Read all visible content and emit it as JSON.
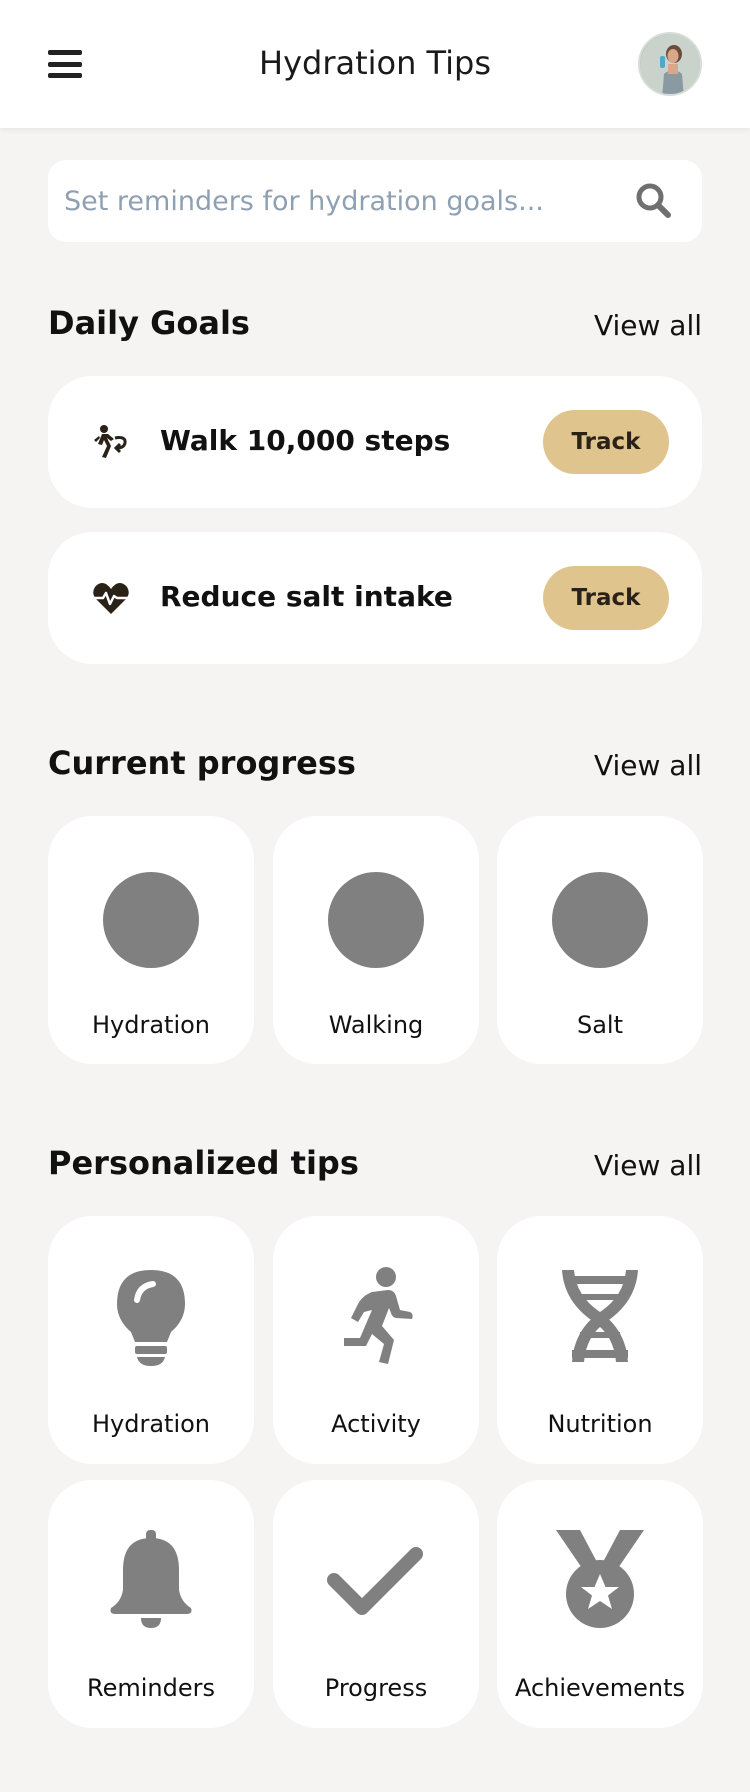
{
  "header": {
    "title": "Hydration Tips",
    "menu_icon": "hamburger-menu-icon",
    "avatar_alt": "User avatar"
  },
  "search": {
    "placeholder": "Set reminders for hydration goals...",
    "value": "",
    "icon": "search-icon"
  },
  "daily_goals": {
    "title": "Daily Goals",
    "view_all": "View all",
    "items": [
      {
        "icon": "walking-icon",
        "label": "Walk 10,000 steps",
        "button": "Track"
      },
      {
        "icon": "heart-pulse-icon",
        "label": "Reduce salt intake",
        "button": "Track"
      }
    ]
  },
  "current_progress": {
    "title": "Current progress",
    "view_all": "View all",
    "items": [
      {
        "label": "Hydration"
      },
      {
        "label": "Walking"
      },
      {
        "label": "Salt"
      }
    ]
  },
  "personalized_tips": {
    "title": "Personalized tips",
    "view_all": "View all",
    "items": [
      {
        "icon": "lightbulb-icon",
        "label": "Hydration"
      },
      {
        "icon": "running-icon",
        "label": "Activity"
      },
      {
        "icon": "dna-icon",
        "label": "Nutrition"
      },
      {
        "icon": "bell-icon",
        "label": "Reminders"
      },
      {
        "icon": "checkmark-icon",
        "label": "Progress"
      },
      {
        "icon": "medal-icon",
        "label": "Achievements"
      }
    ]
  },
  "colors": {
    "background": "#f5f4f2",
    "card": "#ffffff",
    "accent_button": "#dfc48e",
    "icon_gray": "#808080",
    "placeholder": "#8fa0b3"
  }
}
